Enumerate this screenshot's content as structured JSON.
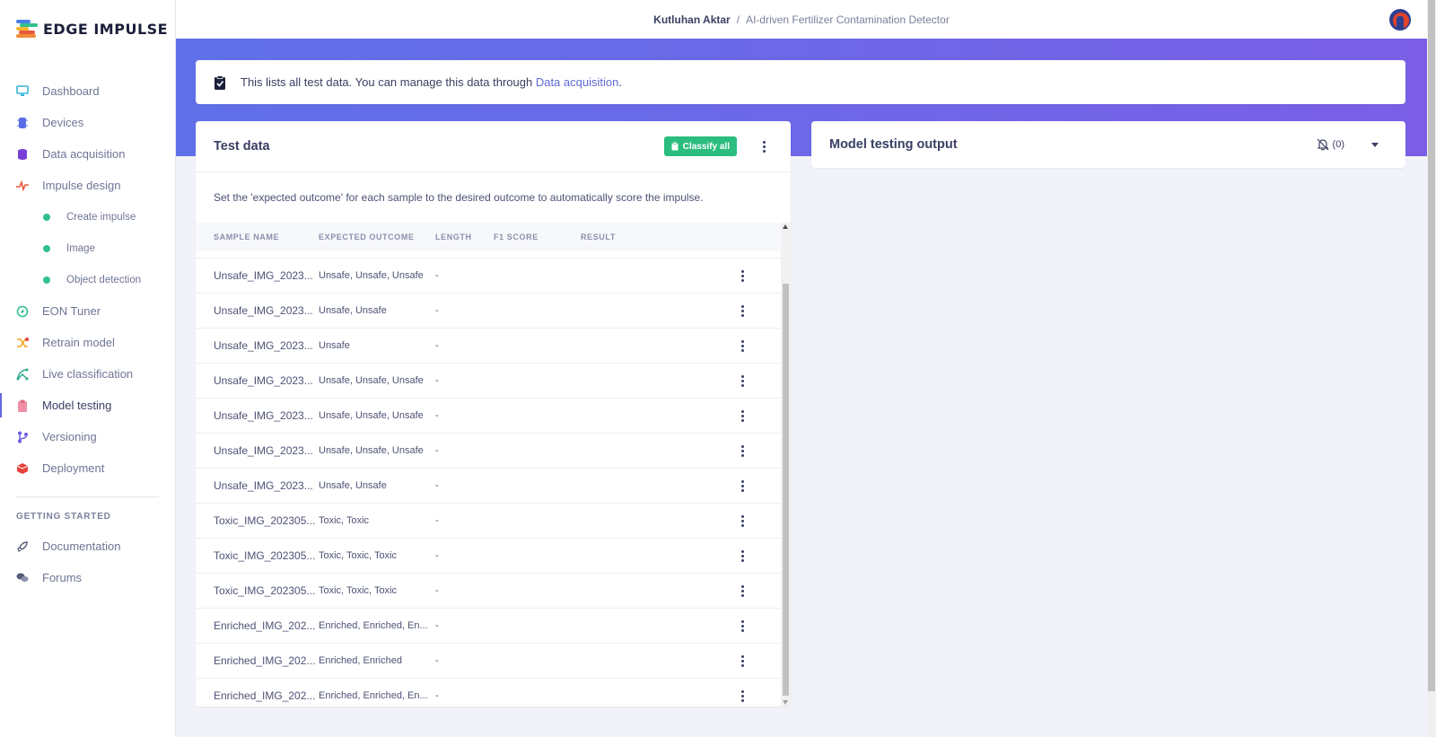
{
  "brand": {
    "name": "EDGE IMPULSE"
  },
  "breadcrumb": {
    "owner": "Kutluhan Aktar",
    "separator": "/",
    "project": "AI-driven Fertilizer Contamination Detector"
  },
  "sidebar": {
    "items": [
      {
        "label": "Dashboard",
        "icon": "monitor-icon"
      },
      {
        "label": "Devices",
        "icon": "chip-icon"
      },
      {
        "label": "Data acquisition",
        "icon": "database-icon"
      },
      {
        "label": "Impulse design",
        "icon": "pulse-icon"
      },
      {
        "label": "Create impulse",
        "icon": "dot-icon"
      },
      {
        "label": "Image",
        "icon": "dot-icon"
      },
      {
        "label": "Object detection",
        "icon": "dot-icon"
      },
      {
        "label": "EON Tuner",
        "icon": "compass-icon"
      },
      {
        "label": "Retrain model",
        "icon": "shuffle-icon"
      },
      {
        "label": "Live classification",
        "icon": "network-icon"
      },
      {
        "label": "Model testing",
        "icon": "clipboard-icon"
      },
      {
        "label": "Versioning",
        "icon": "branch-icon"
      },
      {
        "label": "Deployment",
        "icon": "box-icon"
      }
    ],
    "getting_started_heading": "GETTING STARTED",
    "footer_items": [
      {
        "label": "Documentation",
        "icon": "rocket-icon"
      },
      {
        "label": "Forums",
        "icon": "chat-icon"
      }
    ]
  },
  "info": {
    "text": "This lists all test data. You can manage this data through ",
    "link": "Data acquisition",
    "suffix": "."
  },
  "test_data": {
    "title": "Test data",
    "classify_label": "Classify all",
    "description": "Set the 'expected outcome' for each sample to the desired outcome to automatically score the impulse.",
    "columns": [
      "SAMPLE NAME",
      "EXPECTED OUTCOME",
      "LENGTH",
      "F1 SCORE",
      "RESULT"
    ],
    "rows": [
      {
        "name": "Unsafe_IMG_2023...",
        "expected": "Unsafe, Unsafe, Unsafe",
        "length": "-"
      },
      {
        "name": "Unsafe_IMG_2023...",
        "expected": "Unsafe, Unsafe",
        "length": "-"
      },
      {
        "name": "Unsafe_IMG_2023...",
        "expected": "Unsafe",
        "length": "-"
      },
      {
        "name": "Unsafe_IMG_2023...",
        "expected": "Unsafe, Unsafe, Unsafe",
        "length": "-"
      },
      {
        "name": "Unsafe_IMG_2023...",
        "expected": "Unsafe, Unsafe, Unsafe",
        "length": "-"
      },
      {
        "name": "Unsafe_IMG_2023...",
        "expected": "Unsafe, Unsafe, Unsafe",
        "length": "-"
      },
      {
        "name": "Unsafe_IMG_2023...",
        "expected": "Unsafe, Unsafe",
        "length": "-"
      },
      {
        "name": "Toxic_IMG_202305...",
        "expected": "Toxic, Toxic",
        "length": "-"
      },
      {
        "name": "Toxic_IMG_202305...",
        "expected": "Toxic, Toxic, Toxic",
        "length": "-"
      },
      {
        "name": "Toxic_IMG_202305...",
        "expected": "Toxic, Toxic, Toxic",
        "length": "-"
      },
      {
        "name": "Enriched_IMG_202...",
        "expected": "Enriched, Enriched, En...",
        "length": "-"
      },
      {
        "name": "Enriched_IMG_202...",
        "expected": "Enriched, Enriched",
        "length": "-"
      },
      {
        "name": "Enriched_IMG_202...",
        "expected": "Enriched, Enriched, En...",
        "length": "-"
      }
    ]
  },
  "output": {
    "title": "Model testing output",
    "count": "(0)"
  },
  "colors": {
    "accent": "#5e6ad2",
    "success": "#2bbd7e",
    "hero_start": "#5f70e8",
    "hero_end": "#7a5fe6"
  }
}
